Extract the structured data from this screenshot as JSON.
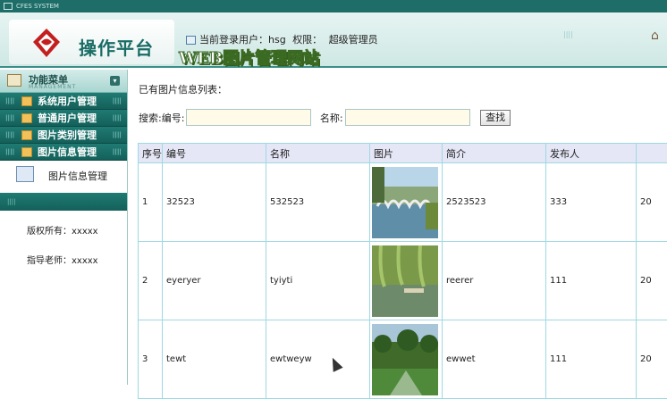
{
  "topbar": {
    "text": "CFES SYSTEM"
  },
  "header": {
    "logo_text": "操作平台",
    "site_name": "WEB图片管理网站",
    "user_label": "当前登录用户：",
    "user_value": "hsg",
    "role_label": "权限：",
    "role_value": "超级管理员"
  },
  "sidebar": {
    "title": "功能菜单",
    "subtitle": "MANAGEMENT",
    "items": [
      {
        "label": "系统用户管理"
      },
      {
        "label": "普通用户管理"
      },
      {
        "label": "图片类别管理"
      },
      {
        "label": "图片信息管理"
      }
    ],
    "active_sub": "图片信息管理",
    "copyright_label": "版权所有：",
    "copyright_value": "xxxxx",
    "teacher_label": "指导老师：",
    "teacher_value": "xxxxx"
  },
  "main": {
    "caption": "已有图片信息列表：",
    "search": {
      "label": "搜索:编号:",
      "id_value": "",
      "name_label": "名称:",
      "name_value": "",
      "button": "查找"
    },
    "columns": [
      "序号",
      "编号",
      "名称",
      "图片",
      "简介",
      "发布人",
      ""
    ],
    "rows": [
      {
        "seq": "1",
        "code": "32523",
        "name": "532523",
        "intro": "2523523",
        "publisher": "333",
        "extra": "20"
      },
      {
        "seq": "2",
        "code": "eyeryer",
        "name": "tyiyti",
        "intro": "reerer",
        "publisher": "111",
        "extra": "20"
      },
      {
        "seq": "3",
        "code": "tewt",
        "name": "ewtweyw",
        "intro": "ewwet",
        "publisher": "111",
        "extra": "20"
      }
    ]
  },
  "colors": {
    "accent": "#1f7b73",
    "header_bg": "#e5e6f6",
    "grid": "#9dd9e3"
  }
}
